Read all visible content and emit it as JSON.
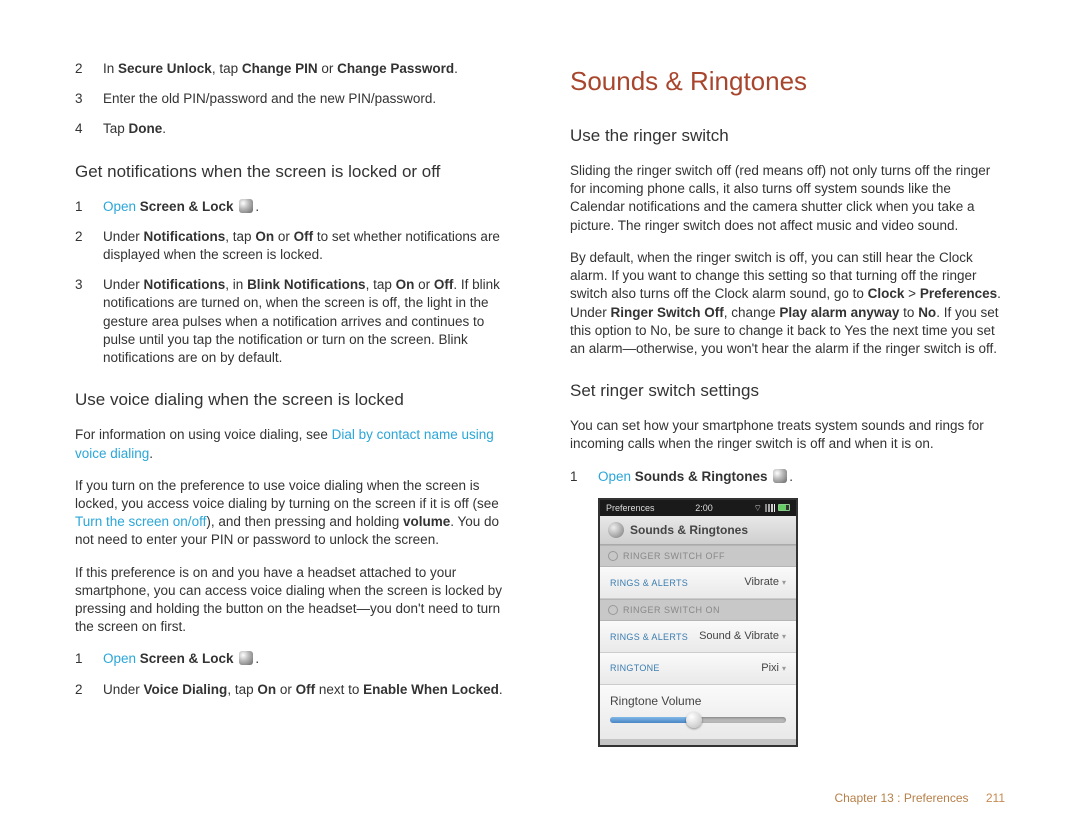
{
  "left": {
    "step2_pre": "In ",
    "step2_b1": "Secure Unlock",
    "step2_mid": ", tap ",
    "step2_b2": "Change PIN",
    "step2_mid2": " or ",
    "step2_b3": "Change Password",
    "step2_end": ".",
    "step3": "Enter the old PIN/password and the new PIN/password.",
    "step4_pre": "Tap ",
    "step4_b": "Done",
    "step4_end": ".",
    "h_notif": "Get notifications when the screen is locked or off",
    "n1_open": "Open ",
    "n1_b": "Screen & Lock",
    "n1_end": ".",
    "n2_pre": "Under ",
    "n2_b1": "Notifications",
    "n2_mid": ", tap ",
    "n2_b2": "On",
    "n2_mid2": " or ",
    "n2_b3": "Off",
    "n2_end": " to set whether notifications are displayed when the screen is locked.",
    "n3_pre": "Under ",
    "n3_b1": "Notifications",
    "n3_mid": ", in ",
    "n3_b2": "Blink Notifications",
    "n3_mid2": ", tap ",
    "n3_b3": "On",
    "n3_mid3": " or ",
    "n3_b4": "Off",
    "n3_end": ". If blink notifications are turned on, when the screen is off, the light in the gesture area pulses when a notification arrives and continues to pulse until you tap the notification or turn on the screen. Blink notifications are on by default.",
    "h_voice": "Use voice dialing when the screen is locked",
    "vp1_pre": "For information on using voice dialing, see ",
    "vp1_link": "Dial by contact name using voice dialing",
    "vp1_end": ".",
    "vp2_pre": "If you turn on the preference to use voice dialing when the screen is locked, you access voice dialing by turning on the screen if it is off (see ",
    "vp2_link": "Turn the screen on/off",
    "vp2_mid": "), and then pressing and holding ",
    "vp2_b": "volume",
    "vp2_end": ". You do not need to enter your PIN or password to unlock the screen.",
    "vp3": "If this preference is on and you have a headset attached to your smartphone, you can access voice dialing when the screen is locked by pressing and holding the button on the headset—you don't need to turn the screen on first.",
    "v1_open": "Open ",
    "v1_b": "Screen & Lock",
    "v1_end": ".",
    "v2_pre": "Under ",
    "v2_b1": "Voice Dialing",
    "v2_mid": ", tap ",
    "v2_b2": "On",
    "v2_mid2": " or ",
    "v2_b3": "Off",
    "v2_mid3": " next to ",
    "v2_b4": "Enable When Locked",
    "v2_end": "."
  },
  "right": {
    "title": "Sounds & Ringtones",
    "h_ringer": "Use the ringer switch",
    "rp1": "Sliding the ringer switch off (red means off) not only turns off the ringer for incoming phone calls, it also turns off system sounds like the Calendar notifications and the camera shutter click when you take a picture. The ringer switch does not affect music and video sound.",
    "rp2_pre": "By default, when the ringer switch is off, you can still hear the Clock alarm. If you want to change this setting so that turning off the ringer switch also turns off the Clock alarm sound, go to ",
    "rp2_b1": "Clock",
    "rp2_gt": " > ",
    "rp2_b2": "Preferences",
    "rp2_mid": ". Under ",
    "rp2_b3": "Ringer Switch Off",
    "rp2_mid2": ", change ",
    "rp2_b4": "Play alarm anyway",
    "rp2_mid3": " to ",
    "rp2_b5": "No",
    "rp2_end": ". If you set this option to No, be sure to change it back to Yes the next time you set an alarm—otherwise, you won't hear the alarm if the ringer switch is off.",
    "h_set": "Set ringer switch settings",
    "sp1": "You can set how your smartphone treats system sounds and rings for incoming calls when the ringer switch is off and when it is on.",
    "s1_open": "Open ",
    "s1_b": "Sounds & Ringtones",
    "s1_end": "."
  },
  "shot": {
    "status_left": "Preferences",
    "status_time": "2:00",
    "header": "Sounds & Ringtones",
    "sect_off": "RINGER SWITCH OFF",
    "row1_lab": "RINGS & ALERTS",
    "row1_val": "Vibrate",
    "sect_on": "RINGER SWITCH ON",
    "row2_lab": "RINGS & ALERTS",
    "row2_val": "Sound & Vibrate",
    "row3_lab": "RINGTONE",
    "row3_val": "Pixi",
    "slider_lab": "Ringtone Volume"
  },
  "footer": {
    "chapter": "Chapter 13 : Preferences",
    "page": "211"
  },
  "nums": {
    "n1": "1",
    "n2": "2",
    "n3": "3",
    "n4": "4"
  }
}
